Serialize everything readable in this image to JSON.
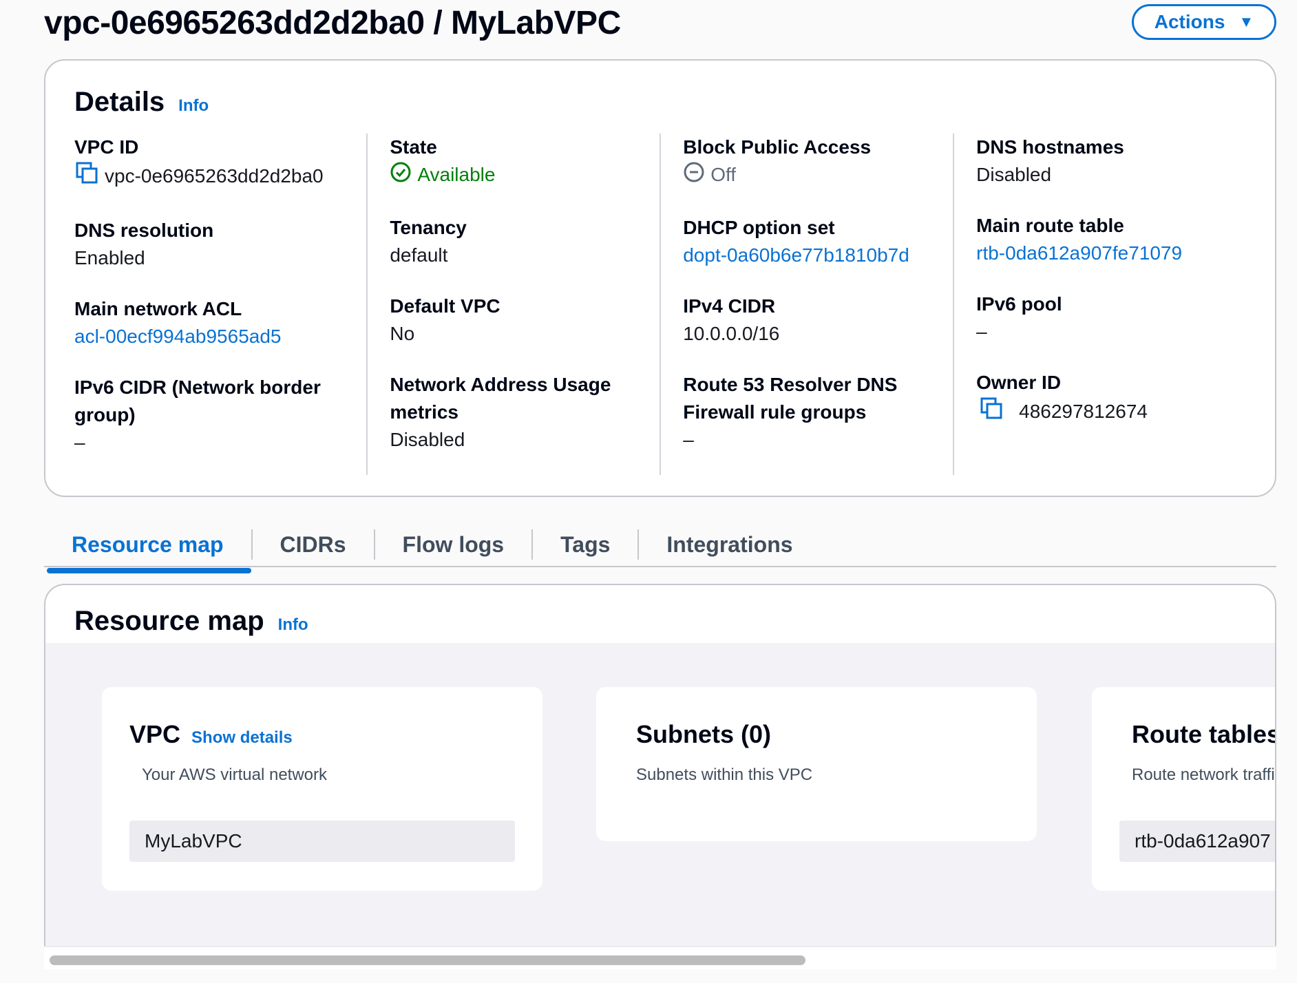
{
  "header": {
    "title": "vpc-0e6965263dd2d2ba0 / MyLabVPC",
    "actions_label": "Actions"
  },
  "details": {
    "title": "Details",
    "info": "Info",
    "columns": [
      [
        {
          "label": "VPC ID",
          "value": "vpc-0e6965263dd2d2ba0",
          "copy_icon": true
        },
        {
          "label": "DNS resolution",
          "value": "Enabled"
        },
        {
          "label": "Main network ACL",
          "value": "acl-00ecf994ab9565ad5",
          "link": true
        },
        {
          "label": "IPv6 CIDR (Network border group)",
          "value": "–"
        }
      ],
      [
        {
          "label": "State",
          "value": "Available",
          "status": "success"
        },
        {
          "label": "Tenancy",
          "value": "default"
        },
        {
          "label": "Default VPC",
          "value": "No"
        },
        {
          "label": "Network Address Usage metrics",
          "value": "Disabled"
        }
      ],
      [
        {
          "label": "Block Public Access",
          "value": "Off",
          "status": "off"
        },
        {
          "label": "DHCP option set",
          "value": "dopt-0a60b6e77b1810b7d",
          "link": true
        },
        {
          "label": "IPv4 CIDR",
          "value": "10.0.0.0/16"
        },
        {
          "label": "Route 53 Resolver DNS Firewall rule groups",
          "value": "–"
        }
      ],
      [
        {
          "label": "DNS hostnames",
          "value": "Disabled"
        },
        {
          "label": "Main route table",
          "value": "rtb-0da612a907fe71079",
          "link": true
        },
        {
          "label": "IPv6 pool",
          "value": "–"
        },
        {
          "label": "Owner ID",
          "value": "486297812674",
          "copy_icon": true
        }
      ]
    ]
  },
  "tabs": [
    {
      "label": "Resource map",
      "active": true
    },
    {
      "label": "CIDRs",
      "active": false
    },
    {
      "label": "Flow logs",
      "active": false
    },
    {
      "label": "Tags",
      "active": false
    },
    {
      "label": "Integrations",
      "active": false
    }
  ],
  "resource_map": {
    "title": "Resource map",
    "info": "Info",
    "vpc": {
      "title": "VPC",
      "show_details": "Show details",
      "subtitle": "Your AWS virtual network",
      "item": "MyLabVPC"
    },
    "subnets": {
      "title": "Subnets (0)",
      "subtitle": "Subnets within this VPC"
    },
    "route_tables": {
      "title": "Route tables",
      "subtitle": "Route network traffi",
      "item": "rtb-0da612a907"
    }
  },
  "colors": {
    "link": "#0972d3",
    "success": "#037f0c",
    "border": "#c6c6cd"
  }
}
